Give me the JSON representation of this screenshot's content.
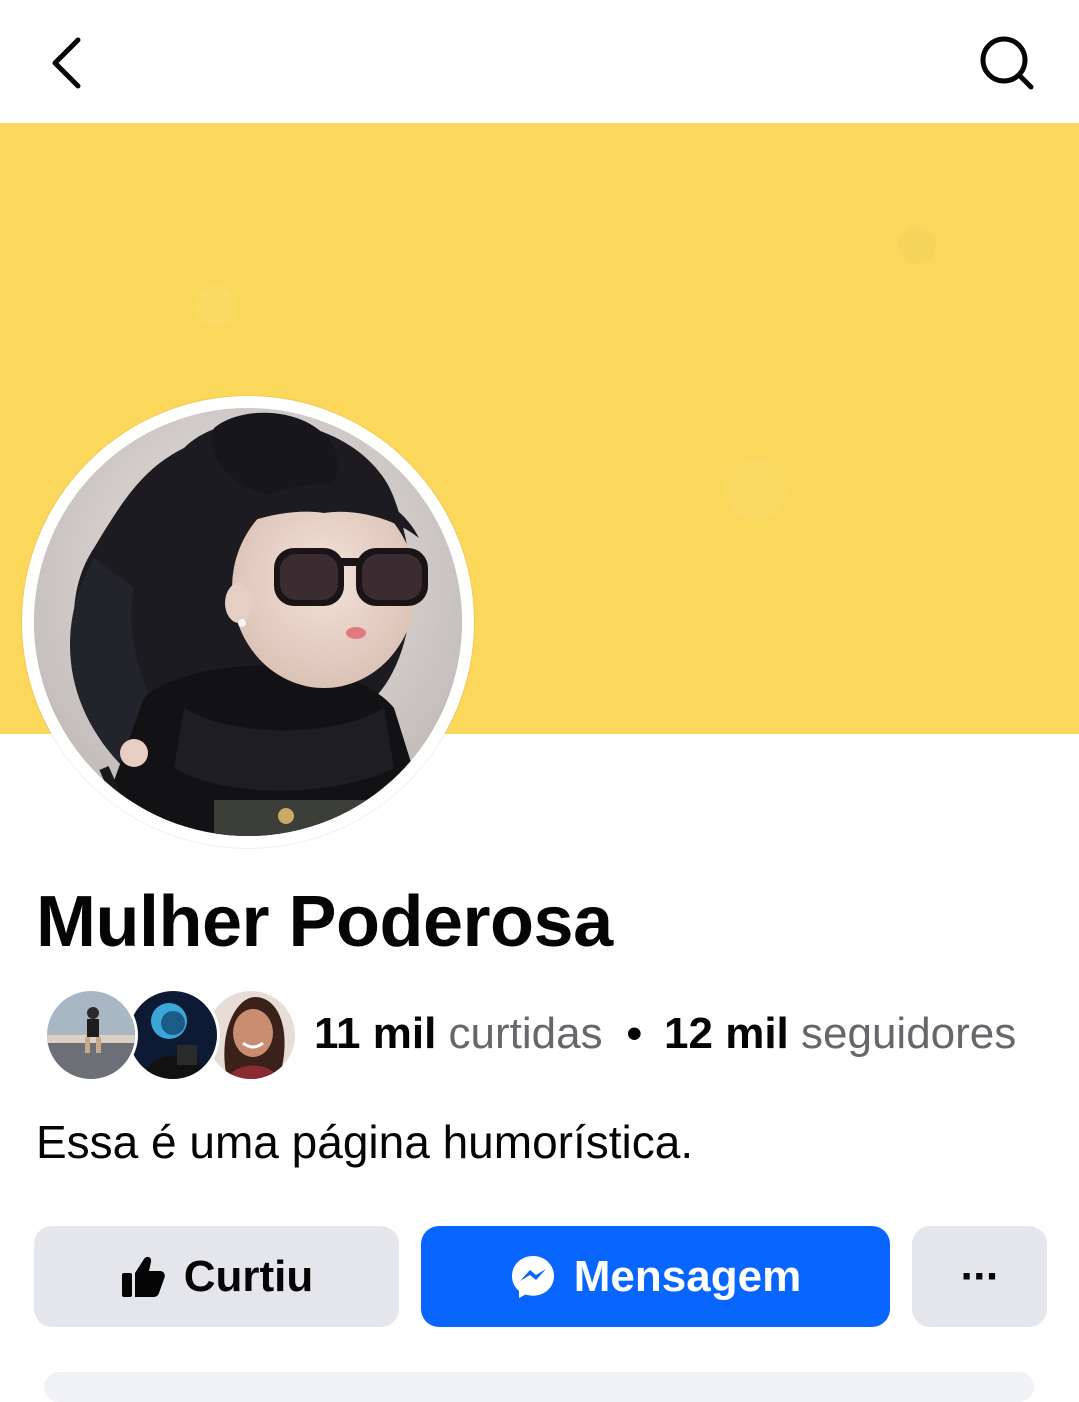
{
  "header": {
    "back_icon": "chevron-left-icon",
    "search_icon": "search-icon"
  },
  "cover": {
    "color": "#fbd85b"
  },
  "profile": {
    "name": "Mulher Poderosa",
    "avatar_description": "doll-girl-sunglasses-avatar"
  },
  "stats": {
    "likes_count": "11 mil",
    "likes_label": "curtidas",
    "separator": "•",
    "followers_count": "12 mil",
    "followers_label": "seguidores",
    "friend_avatars": [
      "friend-avatar-1",
      "friend-avatar-2",
      "friend-avatar-3"
    ]
  },
  "bio": {
    "text": "Essa é uma página humorística."
  },
  "actions": {
    "like_label": "Curtiu",
    "like_icon": "thumbs-up-icon",
    "message_label": "Mensagem",
    "message_icon": "messenger-icon",
    "more_label": "···",
    "accent_color": "#0866ff"
  }
}
